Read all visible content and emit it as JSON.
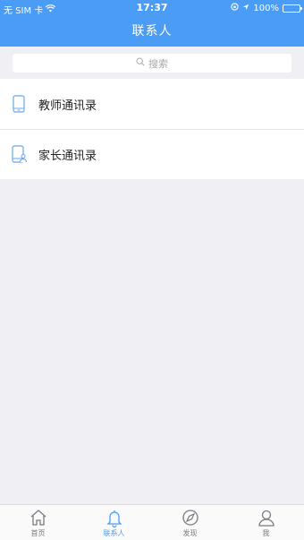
{
  "status_bar": {
    "carrier": "无 SIM 卡",
    "time": "17:37",
    "battery": "100%"
  },
  "header": {
    "title": "联系人"
  },
  "search": {
    "placeholder": "搜索"
  },
  "contacts": [
    {
      "label": "教师通讯录",
      "icon": "phone-icon"
    },
    {
      "label": "家长通讯录",
      "icon": "phone-person-icon"
    }
  ],
  "tabs": [
    {
      "label": "首页",
      "icon": "home-icon",
      "active": false
    },
    {
      "label": "联系人",
      "icon": "bell-icon",
      "active": true
    },
    {
      "label": "发现",
      "icon": "compass-icon",
      "active": false
    },
    {
      "label": "我",
      "icon": "user-icon",
      "active": false
    }
  ],
  "colors": {
    "accent": "#4a9cf5",
    "background": "#efeff4"
  }
}
